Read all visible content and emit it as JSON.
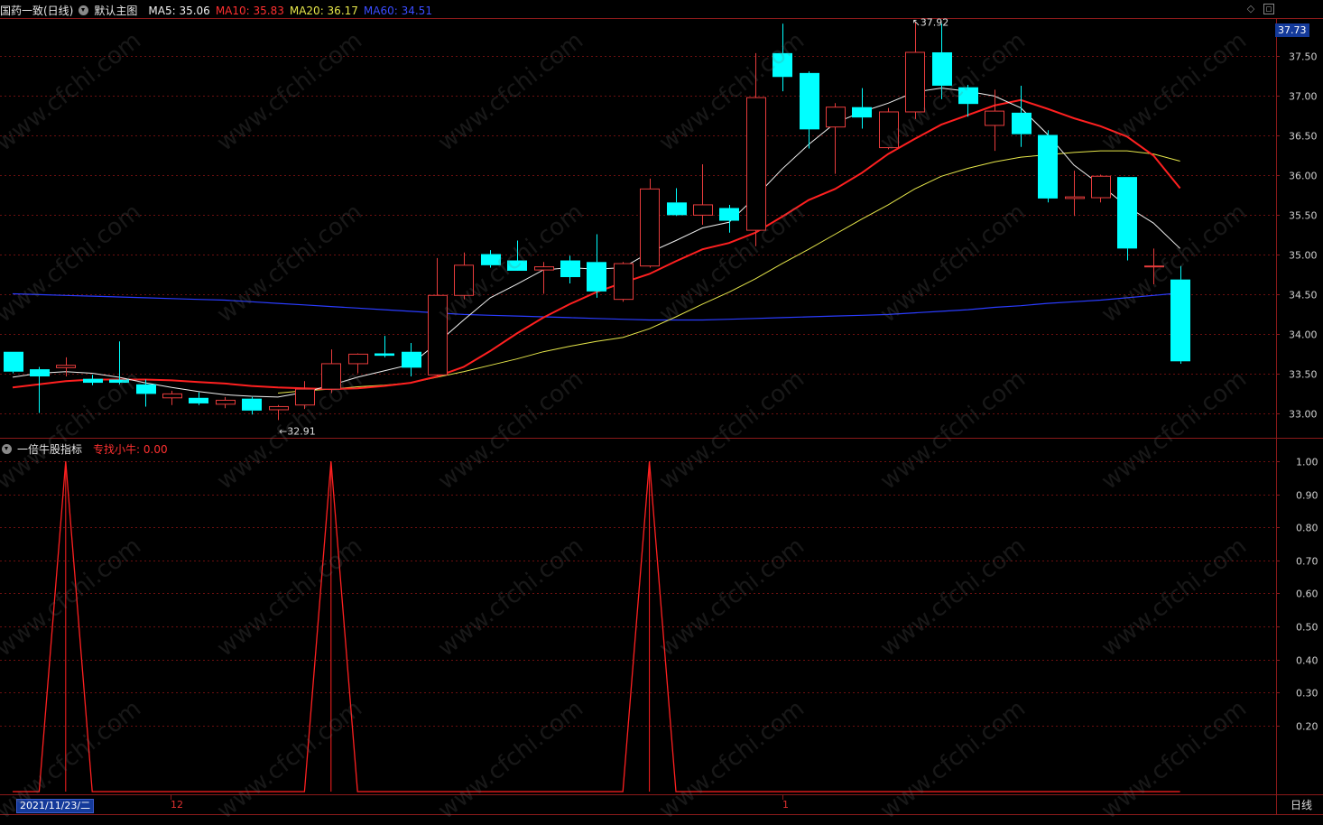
{
  "header": {
    "stock_label": "国药一致(日线)",
    "main_label": "默认主图",
    "ma5": "MA5: 35.06",
    "ma10": "MA10: 35.83",
    "ma20": "MA20: 36.17",
    "ma60": "MA60: 34.51"
  },
  "sub_header": {
    "indicator_label": "一倍牛股指标",
    "signal_label": "专找小牛: 0.00"
  },
  "price_tag": "37.73",
  "annotations": {
    "high": "37.92",
    "low": "32.91"
  },
  "x_axis": {
    "date_label": "2021/11/23/二",
    "month_marks": [
      "12",
      "1"
    ]
  },
  "period_label": "日线",
  "watermark": "www.cfchi.com",
  "colors": {
    "up": "#e83c3c",
    "down": "#00ffff",
    "ma5": "#f0f0f0",
    "ma10": "#ff2020",
    "ma20": "#e6e64a",
    "ma60": "#2a3cff",
    "grid": "#6b0f0f",
    "axis": "#8b1a1a",
    "signal": "#ff2020"
  },
  "chart_data": [
    {
      "type": "candlestick",
      "title": "国药一致(日线)",
      "ylim": [
        32.7,
        38.0
      ],
      "yticks": [
        "37.50",
        "37.00",
        "36.50",
        "36.00",
        "35.50",
        "35.00",
        "34.50",
        "34.00",
        "33.50",
        "33.00"
      ],
      "ytick_values": [
        37.5,
        37.0,
        36.5,
        36.0,
        35.5,
        35.0,
        34.5,
        34.0,
        33.5,
        33.0
      ],
      "grid": true,
      "candles": [
        {
          "o": 33.77,
          "h": 33.77,
          "l": 33.5,
          "c": 33.52
        },
        {
          "o": 33.55,
          "h": 33.58,
          "l": 33.0,
          "c": 33.46
        },
        {
          "o": 33.57,
          "h": 33.7,
          "l": 33.46,
          "c": 33.6
        },
        {
          "o": 33.43,
          "h": 33.48,
          "l": 33.35,
          "c": 33.38
        },
        {
          "o": 33.42,
          "h": 33.9,
          "l": 33.36,
          "c": 33.38
        },
        {
          "o": 33.36,
          "h": 33.42,
          "l": 33.08,
          "c": 33.24
        },
        {
          "o": 33.19,
          "h": 33.28,
          "l": 33.1,
          "c": 33.24
        },
        {
          "o": 33.19,
          "h": 33.26,
          "l": 33.1,
          "c": 33.12
        },
        {
          "o": 33.11,
          "h": 33.2,
          "l": 33.06,
          "c": 33.16
        },
        {
          "o": 33.18,
          "h": 33.2,
          "l": 32.98,
          "c": 33.03
        },
        {
          "o": 33.04,
          "h": 33.1,
          "l": 32.91,
          "c": 33.08
        },
        {
          "o": 33.1,
          "h": 33.4,
          "l": 33.05,
          "c": 33.3
        },
        {
          "o": 33.3,
          "h": 33.8,
          "l": 33.25,
          "c": 33.62
        },
        {
          "o": 33.62,
          "h": 33.75,
          "l": 33.5,
          "c": 33.74
        },
        {
          "o": 33.75,
          "h": 33.97,
          "l": 33.7,
          "c": 33.72
        },
        {
          "o": 33.77,
          "h": 33.88,
          "l": 33.46,
          "c": 33.57
        },
        {
          "o": 33.48,
          "h": 34.95,
          "l": 33.46,
          "c": 34.48
        },
        {
          "o": 34.48,
          "h": 35.02,
          "l": 34.43,
          "c": 34.86
        },
        {
          "o": 35.0,
          "h": 35.05,
          "l": 34.83,
          "c": 34.86
        },
        {
          "o": 34.92,
          "h": 35.17,
          "l": 34.8,
          "c": 34.79
        },
        {
          "o": 34.8,
          "h": 34.9,
          "l": 34.5,
          "c": 34.84
        },
        {
          "o": 34.92,
          "h": 34.98,
          "l": 34.63,
          "c": 34.71
        },
        {
          "o": 34.9,
          "h": 35.25,
          "l": 34.45,
          "c": 34.53
        },
        {
          "o": 34.43,
          "h": 34.9,
          "l": 34.4,
          "c": 34.88
        },
        {
          "o": 34.85,
          "h": 35.95,
          "l": 34.83,
          "c": 35.82
        },
        {
          "o": 35.65,
          "h": 35.83,
          "l": 35.48,
          "c": 35.49
        },
        {
          "o": 35.49,
          "h": 36.13,
          "l": 35.37,
          "c": 35.62
        },
        {
          "o": 35.58,
          "h": 35.62,
          "l": 35.27,
          "c": 35.42
        },
        {
          "o": 35.3,
          "h": 37.53,
          "l": 35.1,
          "c": 36.97
        },
        {
          "o": 37.53,
          "h": 37.9,
          "l": 37.05,
          "c": 37.23
        },
        {
          "o": 37.28,
          "h": 37.3,
          "l": 36.33,
          "c": 36.57
        },
        {
          "o": 36.6,
          "h": 36.9,
          "l": 36.01,
          "c": 36.85
        },
        {
          "o": 36.85,
          "h": 37.09,
          "l": 36.58,
          "c": 36.72
        },
        {
          "o": 36.34,
          "h": 36.84,
          "l": 36.32,
          "c": 36.79
        },
        {
          "o": 36.79,
          "h": 37.92,
          "l": 36.7,
          "c": 37.54
        },
        {
          "o": 37.54,
          "h": 37.9,
          "l": 36.95,
          "c": 37.12
        },
        {
          "o": 37.1,
          "h": 37.13,
          "l": 36.73,
          "c": 36.89
        },
        {
          "o": 36.62,
          "h": 37.07,
          "l": 36.3,
          "c": 36.8
        },
        {
          "o": 36.78,
          "h": 37.12,
          "l": 36.35,
          "c": 36.51
        },
        {
          "o": 36.5,
          "h": 36.56,
          "l": 35.65,
          "c": 35.7
        },
        {
          "o": 35.7,
          "h": 36.05,
          "l": 35.48,
          "c": 35.72
        },
        {
          "o": 35.71,
          "h": 36.0,
          "l": 35.65,
          "c": 35.98
        },
        {
          "o": 35.97,
          "h": 35.97,
          "l": 34.92,
          "c": 35.07
        },
        {
          "o": 34.85,
          "h": 35.07,
          "l": 34.62,
          "c": 34.85
        },
        {
          "o": 34.68,
          "h": 34.85,
          "l": 33.62,
          "c": 33.65
        }
      ],
      "ma5": [
        33.45,
        33.5,
        33.52,
        33.5,
        33.45,
        33.38,
        33.32,
        33.27,
        33.23,
        33.21,
        33.2,
        33.26,
        33.35,
        33.45,
        33.53,
        33.61,
        33.88,
        34.17,
        34.45,
        34.62,
        34.8,
        34.83,
        34.81,
        34.83,
        35.02,
        35.17,
        35.33,
        35.4,
        35.72,
        36.07,
        36.38,
        36.65,
        36.79,
        36.9,
        37.04,
        37.09,
        37.05,
        36.99,
        36.84,
        36.51,
        36.12,
        35.87,
        35.6,
        35.39,
        35.07
      ],
      "ma10": [
        33.32,
        33.36,
        33.4,
        33.42,
        33.42,
        33.42,
        33.41,
        33.39,
        33.37,
        33.34,
        33.32,
        33.31,
        33.3,
        33.31,
        33.34,
        33.38,
        33.46,
        33.58,
        33.78,
        34.0,
        34.2,
        34.37,
        34.52,
        34.64,
        34.75,
        34.91,
        35.06,
        35.14,
        35.27,
        35.47,
        35.68,
        35.82,
        36.02,
        36.26,
        36.45,
        36.63,
        36.75,
        36.87,
        36.94,
        36.83,
        36.71,
        36.61,
        36.48,
        36.24,
        35.83
      ],
      "ma20": [
        null,
        null,
        null,
        null,
        null,
        null,
        null,
        null,
        null,
        null,
        33.25,
        33.28,
        33.3,
        33.33,
        33.35,
        33.38,
        33.45,
        33.52,
        33.6,
        33.68,
        33.77,
        33.84,
        33.9,
        33.95,
        34.06,
        34.21,
        34.37,
        34.52,
        34.69,
        34.88,
        35.06,
        35.25,
        35.44,
        35.62,
        35.82,
        35.98,
        36.08,
        36.16,
        36.22,
        36.25,
        36.28,
        36.3,
        36.3,
        36.26,
        36.17
      ],
      "ma60": [
        34.5,
        34.49,
        34.48,
        34.47,
        34.46,
        34.45,
        34.44,
        34.43,
        34.42,
        34.4,
        34.38,
        34.36,
        34.34,
        34.32,
        34.3,
        34.28,
        34.26,
        34.24,
        34.23,
        34.22,
        34.21,
        34.2,
        34.19,
        34.18,
        34.17,
        34.17,
        34.17,
        34.18,
        34.19,
        34.2,
        34.21,
        34.22,
        34.23,
        34.24,
        34.26,
        34.28,
        34.3,
        34.33,
        34.35,
        34.38,
        34.4,
        34.42,
        34.45,
        34.48,
        34.51
      ]
    },
    {
      "type": "line",
      "title": "一倍牛股指标",
      "series": [
        {
          "name": "专找小牛"
        }
      ],
      "ylim": [
        0,
        1.05
      ],
      "yticks": [
        "1.00",
        "0.90",
        "0.80",
        "0.70",
        "0.60",
        "0.50",
        "0.40",
        "0.30",
        "0.20"
      ],
      "ytick_values": [
        1.0,
        0.9,
        0.8,
        0.7,
        0.6,
        0.5,
        0.4,
        0.3,
        0.2
      ],
      "values": [
        0,
        0,
        1,
        0,
        0,
        0,
        0,
        0,
        0,
        0,
        0,
        0,
        1,
        0,
        0,
        0,
        0,
        0,
        0,
        0,
        0,
        0,
        0,
        0,
        1,
        0,
        0,
        0,
        0,
        0,
        0,
        0,
        0,
        0,
        0,
        0,
        0,
        0,
        0,
        0,
        0,
        0,
        0,
        0,
        0
      ]
    }
  ]
}
